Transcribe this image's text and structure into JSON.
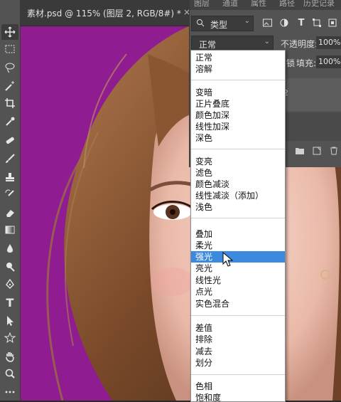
{
  "document_tab": {
    "title": "素材.psd @ 115% (图层 2, RGB/8#) *",
    "close": "×"
  },
  "toolbar": {
    "tools": [
      {
        "name": "move-tool",
        "icon": "move-icon"
      },
      {
        "name": "marquee-tool",
        "icon": "rect-marquee-icon"
      },
      {
        "name": "lasso-tool",
        "icon": "lasso-icon"
      },
      {
        "name": "magic-wand-tool",
        "icon": "magic-wand-icon"
      },
      {
        "name": "crop-tool",
        "icon": "crop-icon"
      },
      {
        "name": "eyedropper-tool",
        "icon": "eyedropper-icon"
      },
      {
        "name": "healing-tool",
        "icon": "bandage-icon"
      },
      {
        "name": "brush-tool",
        "icon": "brush-icon"
      },
      {
        "name": "stamp-tool",
        "icon": "stamp-icon"
      },
      {
        "name": "history-brush-tool",
        "icon": "history-brush-icon"
      },
      {
        "name": "eraser-tool",
        "icon": "eraser-icon"
      },
      {
        "name": "gradient-tool",
        "icon": "gradient-icon"
      },
      {
        "name": "blur-tool",
        "icon": "drop-icon"
      },
      {
        "name": "dodge-tool",
        "icon": "dodge-icon"
      },
      {
        "name": "pen-tool",
        "icon": "pen-icon"
      },
      {
        "name": "type-tool",
        "icon": "type-icon",
        "glyph": "T"
      },
      {
        "name": "path-select-tool",
        "icon": "arrow-icon"
      },
      {
        "name": "shape-tool",
        "icon": "star-shape-icon"
      },
      {
        "name": "hand-tool",
        "icon": "hand-icon"
      },
      {
        "name": "zoom-tool",
        "icon": "zoom-icon"
      },
      {
        "name": "more-tools",
        "icon": "ellipsis-icon"
      }
    ]
  },
  "layers_panel": {
    "tabs": [
      "图层",
      "通道",
      "属性",
      "路径",
      "历史记录"
    ],
    "filter_kind": "类型",
    "blend_mode": "正常",
    "opacity_label": "不透明度:",
    "opacity_value": "100%",
    "lock_label": "锁",
    "fill_label": "填充:",
    "fill_value": "100%",
    "layer_fragment": "2"
  },
  "blend_menu": {
    "groups": [
      [
        "正常",
        "溶解"
      ],
      [
        "变暗",
        "正片叠底",
        "颜色加深",
        "线性加深",
        "深色"
      ],
      [
        "变亮",
        "滤色",
        "颜色减淡",
        "线性减淡（添加）",
        "浅色"
      ],
      [
        "叠加",
        "柔光",
        "强光",
        "亮光",
        "线性光",
        "点光",
        "实色混合"
      ],
      [
        "差值",
        "排除",
        "减去",
        "划分"
      ],
      [
        "色相",
        "饱和度"
      ]
    ],
    "selected": "强光"
  },
  "colors": {
    "canvas_bg": "#8f1c91",
    "highlight": "#3b8ae0",
    "panel_bg": "#535353"
  }
}
